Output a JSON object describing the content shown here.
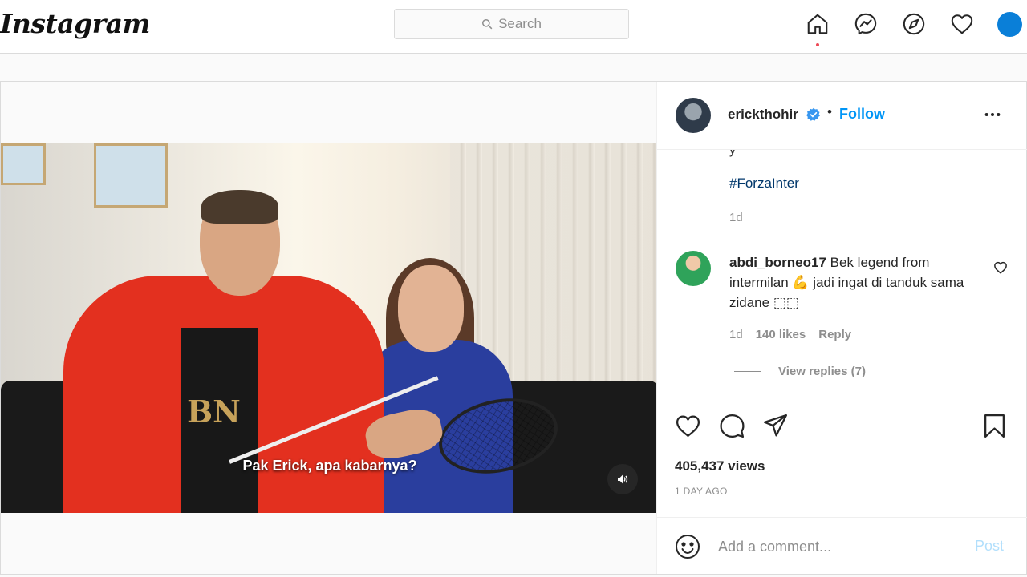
{
  "nav": {
    "logo": "Instagram",
    "search_placeholder": "Search",
    "icons": [
      "home-icon",
      "messenger-icon",
      "explore-icon",
      "activity-heart-icon",
      "profile-avatar"
    ]
  },
  "post": {
    "author": "erickthohir",
    "follow_label": "Follow",
    "separator": "•",
    "video_subtitle": "Pak Erick, apa kabarnya?",
    "caption_tail": "y",
    "hashtag": "#ForzaInter",
    "caption_time": "1d",
    "comment": {
      "user": "abdi_borneo17",
      "text": " Bek legend from intermilan 💪 jadi ingat di tanduk sama zidane ⬚⬚",
      "time": "1d",
      "likes": "140 likes",
      "reply_label": "Reply",
      "view_replies": "View replies (7)"
    },
    "views": "405,437 views",
    "posted_ago": "1 DAY AGO",
    "comment_placeholder": "Add a comment...",
    "post_label": "Post"
  },
  "colors": {
    "accent": "#0095f6",
    "post_disabled": "#b2dffc",
    "notification_dot": "#ed4956"
  }
}
